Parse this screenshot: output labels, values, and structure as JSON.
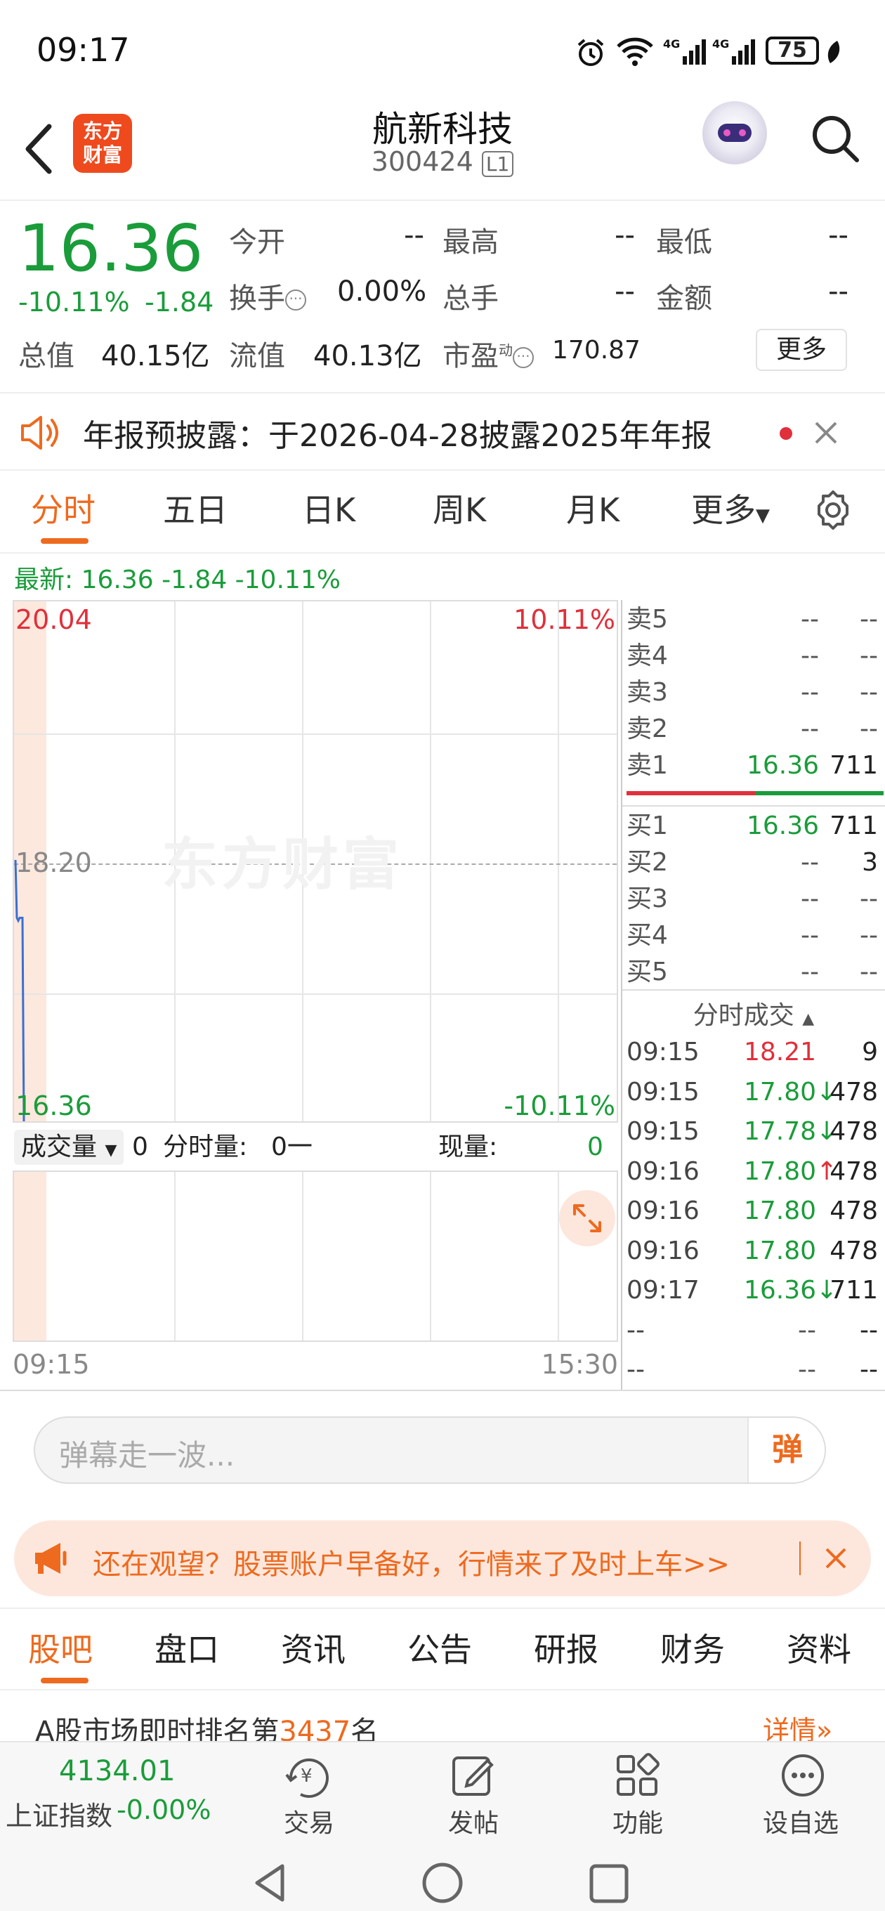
{
  "status_bar": {
    "time": "09:17",
    "battery": "75"
  },
  "header": {
    "stock_name": "航新科技",
    "stock_code": "300424",
    "level_badge": "L1",
    "logo_text": "东方\n财富"
  },
  "quote": {
    "price": "16.36",
    "change_pct": "-10.11%",
    "change": "-1.84",
    "open_label": "今开",
    "open": "--",
    "high_label": "最高",
    "high": "--",
    "low_label": "最低",
    "low": "--",
    "turnover_label": "换手",
    "turnover": "0.00%",
    "volume_label": "总手",
    "volume": "--",
    "amount_label": "金额",
    "amount": "--",
    "mktcap_label": "总值",
    "mktcap": "40.15亿",
    "float_label": "流值",
    "float": "40.13亿",
    "pe_label": "市盈",
    "pe_sup": "动",
    "pe": "170.87",
    "more_label": "更多"
  },
  "notice": {
    "text": "年报预披露：于2026-04-28披露2025年年报"
  },
  "tabs": [
    "分时",
    "五日",
    "日K",
    "周K",
    "月K",
    "更多"
  ],
  "latest_line": "最新: 16.36 -1.84 -10.11%",
  "chart": {
    "watermark": "东方财富",
    "y_top": "20.04",
    "y_mid": "18.20",
    "y_bottom": "16.36",
    "pct_top": "10.11%",
    "pct_bottom": "-10.11%",
    "volume_label": "成交量",
    "volume_val": "0",
    "period_vol_label": "分时量:",
    "period_vol_val": "0一",
    "now_vol_label": "现量:",
    "now_vol_val": "0",
    "x_start": "09:15",
    "x_end": "15:30"
  },
  "chart_data": {
    "type": "line",
    "title": "",
    "x": [
      "09:15",
      "09:15",
      "09:15",
      "09:16",
      "09:16",
      "09:16",
      "09:17"
    ],
    "series": [
      {
        "values": [
          18.21,
          17.8,
          17.78,
          17.8,
          17.8,
          17.8,
          16.36
        ]
      }
    ],
    "ylim": [
      16.36,
      20.04
    ],
    "prev_close": 18.2,
    "x_range": [
      "09:15",
      "15:30"
    ]
  },
  "orderbook": {
    "sell": [
      {
        "label": "卖5",
        "price": "--",
        "vol": "--"
      },
      {
        "label": "卖4",
        "price": "--",
        "vol": "--"
      },
      {
        "label": "卖3",
        "price": "--",
        "vol": "--"
      },
      {
        "label": "卖2",
        "price": "--",
        "vol": "--"
      },
      {
        "label": "卖1",
        "price": "16.36",
        "vol": "711"
      }
    ],
    "buy": [
      {
        "label": "买1",
        "price": "16.36",
        "vol": "711"
      },
      {
        "label": "买2",
        "price": "--",
        "vol": "3"
      },
      {
        "label": "买3",
        "price": "--",
        "vol": "--"
      },
      {
        "label": "买4",
        "price": "--",
        "vol": "--"
      },
      {
        "label": "买5",
        "price": "--",
        "vol": "--"
      }
    ]
  },
  "trades": {
    "title": "分时成交",
    "rows": [
      {
        "time": "09:15",
        "price": "18.21",
        "arrow": "",
        "vol": "9",
        "color": "red"
      },
      {
        "time": "09:15",
        "price": "17.80",
        "arrow": "↓",
        "vol": "478",
        "color": "green"
      },
      {
        "time": "09:15",
        "price": "17.78",
        "arrow": "↓",
        "vol": "478",
        "color": "green"
      },
      {
        "time": "09:16",
        "price": "17.80",
        "arrow": "↑",
        "vol": "478",
        "color": "green"
      },
      {
        "time": "09:16",
        "price": "17.80",
        "arrow": "",
        "vol": "478",
        "color": "green"
      },
      {
        "time": "09:16",
        "price": "17.80",
        "arrow": "",
        "vol": "478",
        "color": "green"
      },
      {
        "time": "09:17",
        "price": "16.36",
        "arrow": "↓",
        "vol": "711",
        "color": "green"
      },
      {
        "time": "--",
        "price": "--",
        "arrow": "",
        "vol": "--",
        "color": "gray"
      },
      {
        "time": "--",
        "price": "--",
        "arrow": "",
        "vol": "--",
        "color": "gray"
      }
    ]
  },
  "danmu": {
    "placeholder": "弹幕走一波...",
    "button": "弹"
  },
  "promo": {
    "text": "还在观望？股票账户早备好，行情来了及时上车>>"
  },
  "bottom_tabs": [
    "股吧",
    "盘口",
    "资讯",
    "公告",
    "研报",
    "财务",
    "资料"
  ],
  "ranking": {
    "prefix": "A股市场即时排名第",
    "rank": "3437",
    "suffix": "名",
    "detail": "详情"
  },
  "footer": {
    "index_value": "4134.01",
    "index_name": "上证指数",
    "index_change": "-0.00%",
    "trade": "交易",
    "post": "发帖",
    "func": "功能",
    "watch": "设自选"
  },
  "colors": {
    "accent": "#ee6a1e",
    "down": "#1a9c3a",
    "up": "#e0303b"
  }
}
